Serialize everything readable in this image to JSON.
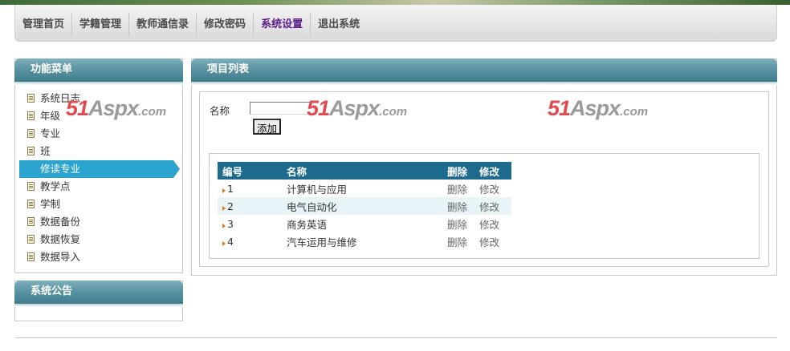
{
  "nav": {
    "items": [
      {
        "label": "管理首页"
      },
      {
        "label": "学籍管理"
      },
      {
        "label": "教师通信录"
      },
      {
        "label": "修改密码"
      },
      {
        "label": "系统设置",
        "active": true
      },
      {
        "label": "退出系统"
      }
    ]
  },
  "menu_panel": {
    "title": "功能菜单",
    "items": [
      {
        "label": "系统日志"
      },
      {
        "label": "年级"
      },
      {
        "label": "专业"
      },
      {
        "label": "班"
      },
      {
        "label": "修读专业",
        "active": true
      },
      {
        "label": "教学点"
      },
      {
        "label": "学制"
      },
      {
        "label": "数据备份"
      },
      {
        "label": "数据恢复"
      },
      {
        "label": "数据导入"
      }
    ]
  },
  "notice_panel": {
    "title": "系统公告"
  },
  "main": {
    "title": "项目列表",
    "form": {
      "name_label": "名称",
      "name_value": "",
      "add_button": "添加"
    },
    "table": {
      "headers": [
        "编号",
        "名称",
        "删除",
        "修改"
      ],
      "rows": [
        {
          "id": "1",
          "name": "计算机与应用",
          "delete": "删除",
          "edit": "修改"
        },
        {
          "id": "2",
          "name": "电气自动化",
          "delete": "删除",
          "edit": "修改"
        },
        {
          "id": "3",
          "name": "商务英语",
          "delete": "删除",
          "edit": "修改"
        },
        {
          "id": "4",
          "name": "汽车运用与维修",
          "delete": "删除",
          "edit": "修改"
        }
      ]
    }
  },
  "watermark": {
    "digits": "51",
    "text": "Aspx",
    "suffix": ".com"
  },
  "colors": {
    "panel_head": "#4f8c9b",
    "active_menu": "#2aa3cf",
    "table_header": "#1d6a8d",
    "nav_active": "#5b1d8a"
  }
}
